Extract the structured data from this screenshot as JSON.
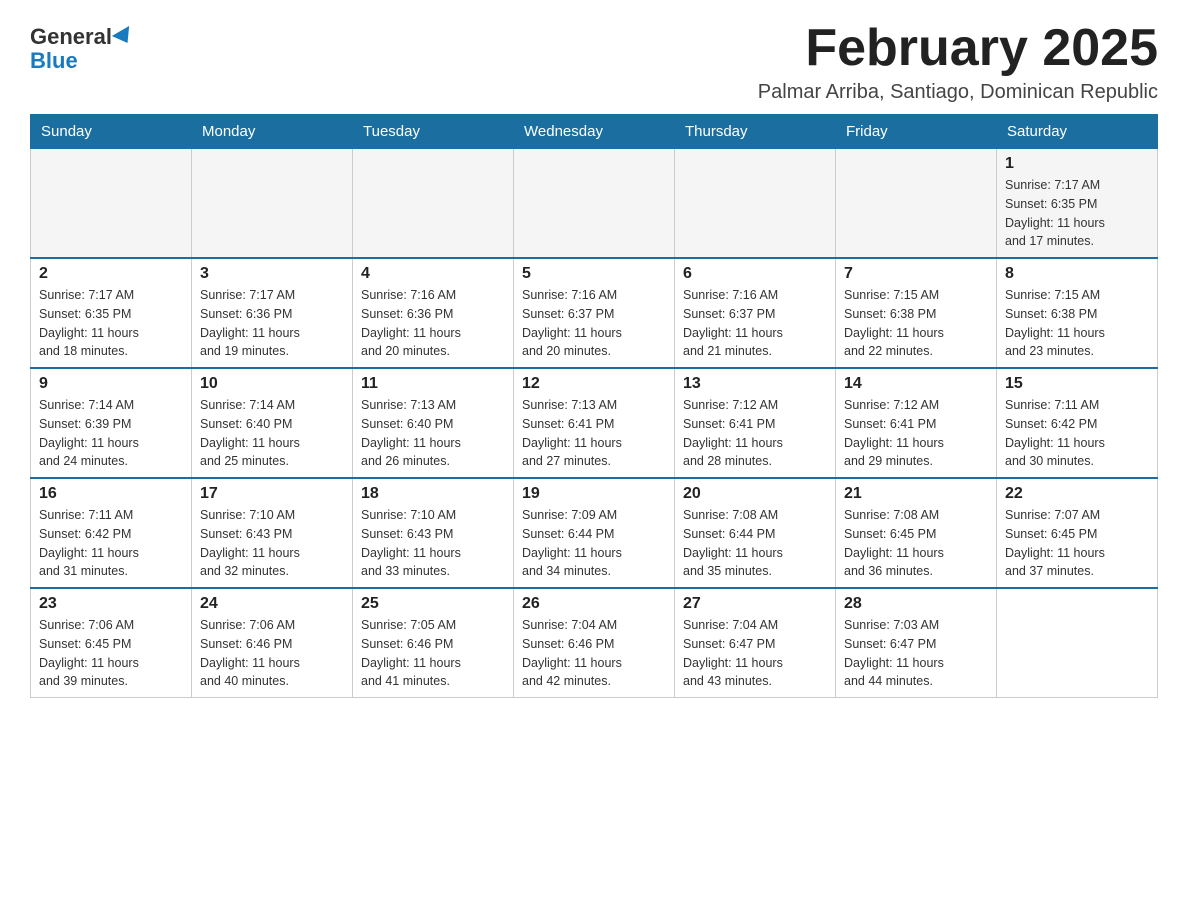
{
  "header": {
    "logo_general": "General",
    "logo_blue": "Blue",
    "title": "February 2025",
    "subtitle": "Palmar Arriba, Santiago, Dominican Republic"
  },
  "weekdays": [
    "Sunday",
    "Monday",
    "Tuesday",
    "Wednesday",
    "Thursday",
    "Friday",
    "Saturday"
  ],
  "weeks": [
    {
      "days": [
        {
          "number": "",
          "info": ""
        },
        {
          "number": "",
          "info": ""
        },
        {
          "number": "",
          "info": ""
        },
        {
          "number": "",
          "info": ""
        },
        {
          "number": "",
          "info": ""
        },
        {
          "number": "",
          "info": ""
        },
        {
          "number": "1",
          "info": "Sunrise: 7:17 AM\nSunset: 6:35 PM\nDaylight: 11 hours\nand 17 minutes."
        }
      ]
    },
    {
      "days": [
        {
          "number": "2",
          "info": "Sunrise: 7:17 AM\nSunset: 6:35 PM\nDaylight: 11 hours\nand 18 minutes."
        },
        {
          "number": "3",
          "info": "Sunrise: 7:17 AM\nSunset: 6:36 PM\nDaylight: 11 hours\nand 19 minutes."
        },
        {
          "number": "4",
          "info": "Sunrise: 7:16 AM\nSunset: 6:36 PM\nDaylight: 11 hours\nand 20 minutes."
        },
        {
          "number": "5",
          "info": "Sunrise: 7:16 AM\nSunset: 6:37 PM\nDaylight: 11 hours\nand 20 minutes."
        },
        {
          "number": "6",
          "info": "Sunrise: 7:16 AM\nSunset: 6:37 PM\nDaylight: 11 hours\nand 21 minutes."
        },
        {
          "number": "7",
          "info": "Sunrise: 7:15 AM\nSunset: 6:38 PM\nDaylight: 11 hours\nand 22 minutes."
        },
        {
          "number": "8",
          "info": "Sunrise: 7:15 AM\nSunset: 6:38 PM\nDaylight: 11 hours\nand 23 minutes."
        }
      ]
    },
    {
      "days": [
        {
          "number": "9",
          "info": "Sunrise: 7:14 AM\nSunset: 6:39 PM\nDaylight: 11 hours\nand 24 minutes."
        },
        {
          "number": "10",
          "info": "Sunrise: 7:14 AM\nSunset: 6:40 PM\nDaylight: 11 hours\nand 25 minutes."
        },
        {
          "number": "11",
          "info": "Sunrise: 7:13 AM\nSunset: 6:40 PM\nDaylight: 11 hours\nand 26 minutes."
        },
        {
          "number": "12",
          "info": "Sunrise: 7:13 AM\nSunset: 6:41 PM\nDaylight: 11 hours\nand 27 minutes."
        },
        {
          "number": "13",
          "info": "Sunrise: 7:12 AM\nSunset: 6:41 PM\nDaylight: 11 hours\nand 28 minutes."
        },
        {
          "number": "14",
          "info": "Sunrise: 7:12 AM\nSunset: 6:41 PM\nDaylight: 11 hours\nand 29 minutes."
        },
        {
          "number": "15",
          "info": "Sunrise: 7:11 AM\nSunset: 6:42 PM\nDaylight: 11 hours\nand 30 minutes."
        }
      ]
    },
    {
      "days": [
        {
          "number": "16",
          "info": "Sunrise: 7:11 AM\nSunset: 6:42 PM\nDaylight: 11 hours\nand 31 minutes."
        },
        {
          "number": "17",
          "info": "Sunrise: 7:10 AM\nSunset: 6:43 PM\nDaylight: 11 hours\nand 32 minutes."
        },
        {
          "number": "18",
          "info": "Sunrise: 7:10 AM\nSunset: 6:43 PM\nDaylight: 11 hours\nand 33 minutes."
        },
        {
          "number": "19",
          "info": "Sunrise: 7:09 AM\nSunset: 6:44 PM\nDaylight: 11 hours\nand 34 minutes."
        },
        {
          "number": "20",
          "info": "Sunrise: 7:08 AM\nSunset: 6:44 PM\nDaylight: 11 hours\nand 35 minutes."
        },
        {
          "number": "21",
          "info": "Sunrise: 7:08 AM\nSunset: 6:45 PM\nDaylight: 11 hours\nand 36 minutes."
        },
        {
          "number": "22",
          "info": "Sunrise: 7:07 AM\nSunset: 6:45 PM\nDaylight: 11 hours\nand 37 minutes."
        }
      ]
    },
    {
      "days": [
        {
          "number": "23",
          "info": "Sunrise: 7:06 AM\nSunset: 6:45 PM\nDaylight: 11 hours\nand 39 minutes."
        },
        {
          "number": "24",
          "info": "Sunrise: 7:06 AM\nSunset: 6:46 PM\nDaylight: 11 hours\nand 40 minutes."
        },
        {
          "number": "25",
          "info": "Sunrise: 7:05 AM\nSunset: 6:46 PM\nDaylight: 11 hours\nand 41 minutes."
        },
        {
          "number": "26",
          "info": "Sunrise: 7:04 AM\nSunset: 6:46 PM\nDaylight: 11 hours\nand 42 minutes."
        },
        {
          "number": "27",
          "info": "Sunrise: 7:04 AM\nSunset: 6:47 PM\nDaylight: 11 hours\nand 43 minutes."
        },
        {
          "number": "28",
          "info": "Sunrise: 7:03 AM\nSunset: 6:47 PM\nDaylight: 11 hours\nand 44 minutes."
        },
        {
          "number": "",
          "info": ""
        }
      ]
    }
  ]
}
